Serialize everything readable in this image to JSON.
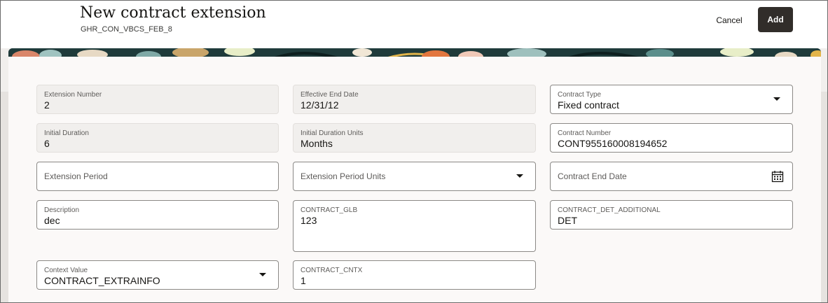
{
  "header": {
    "title": "New contract extension",
    "subtitle": "GHR_CON_VBCS_FEB_8",
    "cancel_label": "Cancel",
    "add_label": "Add"
  },
  "fields": {
    "extension_number": {
      "label": "Extension Number",
      "value": "2"
    },
    "effective_end_date": {
      "label": "Effective End Date",
      "value": "12/31/12"
    },
    "contract_type": {
      "label": "Contract Type",
      "value": "Fixed contract"
    },
    "initial_duration": {
      "label": "Initial Duration",
      "value": "6"
    },
    "initial_duration_units": {
      "label": "Initial Duration Units",
      "value": "Months"
    },
    "contract_number": {
      "label": "Contract Number",
      "value": "CONT955160008194652"
    },
    "extension_period": {
      "placeholder": "Extension Period"
    },
    "extension_period_units": {
      "placeholder": "Extension Period Units"
    },
    "contract_end_date": {
      "placeholder": "Contract End Date"
    },
    "description": {
      "label": "Description",
      "value": "dec"
    },
    "contract_glb": {
      "label": "CONTRACT_GLB",
      "value": "123"
    },
    "contract_det_additional": {
      "label": "CONTRACT_DET_ADDITIONAL",
      "value": "DET"
    },
    "context_value": {
      "label": "Context Value",
      "value": "CONTRACT_EXTRAINFO"
    },
    "contract_cntx": {
      "label": "CONTRACT_CNTX",
      "value": "1"
    }
  },
  "icons": {
    "dropdown": "chevron-down-icon",
    "calendar": "calendar-icon"
  },
  "colors": {
    "primary_button": "#312d2a",
    "panel_background": "#fbf9f8",
    "readonly_field": "#f1efed"
  }
}
